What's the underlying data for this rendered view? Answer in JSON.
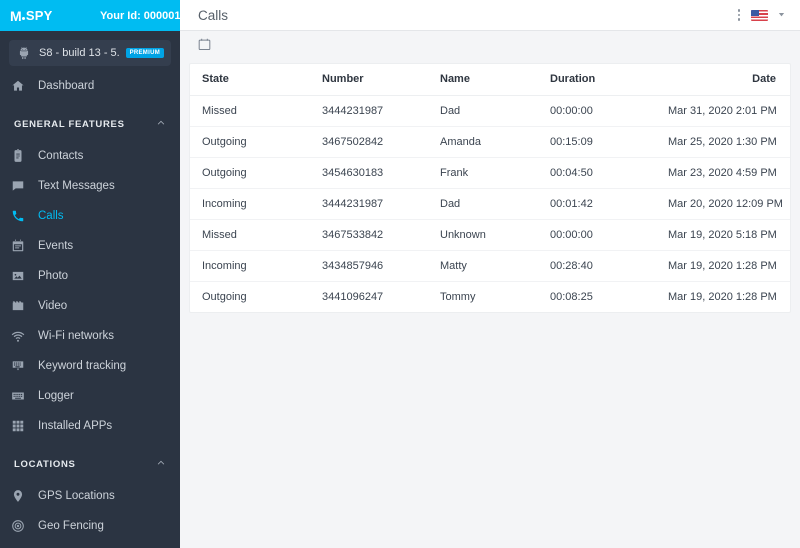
{
  "brand": {
    "logo_text": "M.SPY",
    "logo_m": "M",
    "logo_spy": "SPY",
    "account_id_label": "Your Id: 000001",
    "color": "#00bcf2"
  },
  "sidebar": {
    "device": {
      "name": "S8 - build 13 - 5....",
      "badge": "PREMIUM",
      "icon": "android-icon"
    },
    "dashboard": {
      "label": "Dashboard",
      "icon": "home-icon"
    },
    "sections": [
      {
        "title": "GENERAL FEATURES",
        "collapsed": false,
        "items": [
          {
            "label": "Contacts",
            "icon": "contacts-icon",
            "active": false
          },
          {
            "label": "Text Messages",
            "icon": "message-icon",
            "active": false
          },
          {
            "label": "Calls",
            "icon": "phone-icon",
            "active": true
          },
          {
            "label": "Events",
            "icon": "calendar-icon",
            "active": false
          },
          {
            "label": "Photo",
            "icon": "photo-icon",
            "active": false
          },
          {
            "label": "Video",
            "icon": "video-icon",
            "active": false
          },
          {
            "label": "Wi-Fi networks",
            "icon": "wifi-icon",
            "active": false
          },
          {
            "label": "Keyword tracking",
            "icon": "keyword-icon",
            "active": false
          },
          {
            "label": "Logger",
            "icon": "keyboard-icon",
            "active": false
          },
          {
            "label": "Installed APPs",
            "icon": "apps-grid-icon",
            "active": false
          }
        ]
      },
      {
        "title": "LOCATIONS",
        "collapsed": false,
        "items": [
          {
            "label": "GPS Locations",
            "icon": "map-pin-icon",
            "active": false
          },
          {
            "label": "Geo Fencing",
            "icon": "target-icon",
            "active": false
          }
        ]
      }
    ],
    "active_color": "#00bcf2",
    "background": "#2b3442"
  },
  "header": {
    "title": "Calls",
    "menu_icon": "kebab-menu-icon",
    "language_flag": "us-flag-icon",
    "language_caret": "chevron-down-icon"
  },
  "toolbar": {
    "date_filter_icon": "calendar-icon"
  },
  "table": {
    "columns": [
      "State",
      "Number",
      "Name",
      "Duration",
      "Date"
    ],
    "rows": [
      {
        "state": "Missed",
        "number": "3444231987",
        "name": "Dad",
        "duration": "00:00:00",
        "date": "Mar 31, 2020 2:01 PM"
      },
      {
        "state": "Outgoing",
        "number": "3467502842",
        "name": "Amanda",
        "duration": "00:15:09",
        "date": "Mar 25, 2020 1:30 PM"
      },
      {
        "state": "Outgoing",
        "number": "3454630183",
        "name": "Frank",
        "duration": "00:04:50",
        "date": "Mar 23, 2020 4:59 PM"
      },
      {
        "state": "Incoming",
        "number": "3444231987",
        "name": "Dad",
        "duration": "00:01:42",
        "date": "Mar 20, 2020 12:09 PM"
      },
      {
        "state": "Missed",
        "number": "3467533842",
        "name": "Unknown",
        "duration": "00:00:00",
        "date": "Mar 19, 2020 5:18 PM"
      },
      {
        "state": "Incoming",
        "number": "3434857946",
        "name": "Matty",
        "duration": "00:28:40",
        "date": "Mar 19, 2020 1:28 PM"
      },
      {
        "state": "Outgoing",
        "number": "3441096247",
        "name": "Tommy",
        "duration": "00:08:25",
        "date": "Mar 19, 2020 1:28 PM"
      }
    ]
  }
}
